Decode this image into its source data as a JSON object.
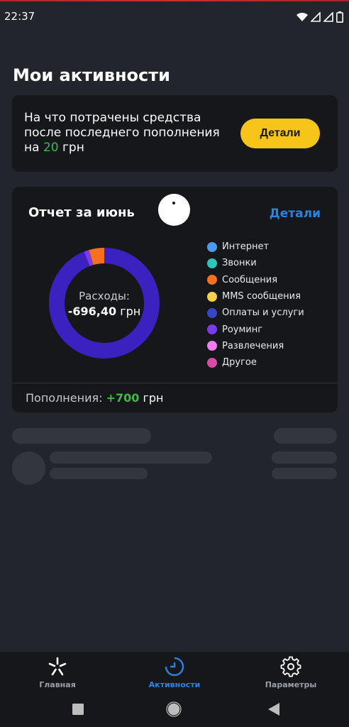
{
  "status": {
    "time": "22:37"
  },
  "page": {
    "title": "Мои активности"
  },
  "spend_card": {
    "text_prefix": "На что потрачены средства после последнего пополнения на ",
    "amount": "20",
    "text_suffix": " грн",
    "button_label": "Детали"
  },
  "report": {
    "title": "Отчет за июнь",
    "details_label": "Детали",
    "center_label": "Расходы:",
    "center_value": "-696,40",
    "center_unit": "грн",
    "legend": [
      {
        "label": "Интернет",
        "color": "#4a9cf0"
      },
      {
        "label": "Звонки",
        "color": "#2fc6b8"
      },
      {
        "label": "Сообщения",
        "color": "#f5701f"
      },
      {
        "label": "MMS сообщения",
        "color": "#f3d14a"
      },
      {
        "label": "Оплаты и услуги",
        "color": "#3945c9"
      },
      {
        "label": "Роуминг",
        "color": "#7a3be8"
      },
      {
        "label": "Развлечения",
        "color": "#f07cf2"
      },
      {
        "label": "Другое",
        "color": "#d84aa6"
      }
    ],
    "footer_label": "Пополнения:",
    "footer_value": "+700",
    "footer_unit": "грн"
  },
  "chart_data": {
    "type": "pie",
    "slices": [
      {
        "name": "Оплаты и услуги",
        "fraction": 0.94,
        "color": "#3a21c0"
      },
      {
        "name": "Роуминг",
        "fraction": 0.015,
        "color": "#7a3be8"
      },
      {
        "name": "Сообщения",
        "fraction": 0.045,
        "color": "#f5701f"
      }
    ]
  },
  "nav": {
    "items": [
      {
        "label": "Главная",
        "icon": "star-logo-icon",
        "active": false
      },
      {
        "label": "Активности",
        "icon": "activity-chart-icon",
        "active": true
      },
      {
        "label": "Параметры",
        "icon": "gear-icon",
        "active": false
      }
    ]
  },
  "system_nav": {
    "icons": [
      "square-recents-icon",
      "circle-home-icon",
      "triangle-back-icon"
    ]
  },
  "colors": {
    "accent": "#2a83e0",
    "brand_yellow": "#f7c51a",
    "positive": "#42b846",
    "card_bg": "#15171b"
  }
}
